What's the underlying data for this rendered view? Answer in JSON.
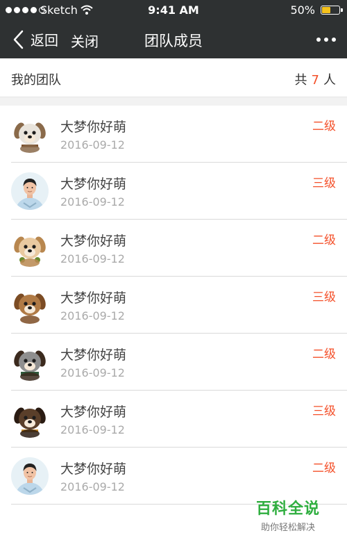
{
  "status_bar": {
    "carrier": "Sketch",
    "time": "9:41 AM",
    "battery": "50%",
    "battery_level": 0.5,
    "signal_bars": 4,
    "signal_total": 5
  },
  "nav": {
    "back_label": "返回",
    "close_label": "关闭",
    "title": "团队成员",
    "more_icon": "more-dots-icon"
  },
  "team": {
    "title": "我的团队",
    "count_prefix": "共",
    "count": "7",
    "count_suffix": "人"
  },
  "members": [
    {
      "name": "大梦你好萌",
      "date": "2016-09-12",
      "level": "二级",
      "avatar": "dog-white-avatar"
    },
    {
      "name": "大梦你好萌",
      "date": "2016-09-12",
      "level": "三级",
      "avatar": "man-avatar"
    },
    {
      "name": "大梦你好萌",
      "date": "2016-09-12",
      "level": "二级",
      "avatar": "dog-cream-avatar"
    },
    {
      "name": "大梦你好萌",
      "date": "2016-09-12",
      "level": "三级",
      "avatar": "dog-brown-avatar"
    },
    {
      "name": "大梦你好萌",
      "date": "2016-09-12",
      "level": "二级",
      "avatar": "dog-green-avatar"
    },
    {
      "name": "大梦你好萌",
      "date": "2016-09-12",
      "level": "三级",
      "avatar": "dog-dark-avatar"
    },
    {
      "name": "大梦你好萌",
      "date": "2016-09-12",
      "level": "二级",
      "avatar": "man-avatar"
    }
  ],
  "watermark": {
    "title": "百科全说",
    "subtitle": "助你轻松解决"
  },
  "colors": {
    "nav_bg": "#2e3132",
    "accent": "#f4502a",
    "battery": "#f5c21b",
    "watermark": "#2fae3f"
  }
}
